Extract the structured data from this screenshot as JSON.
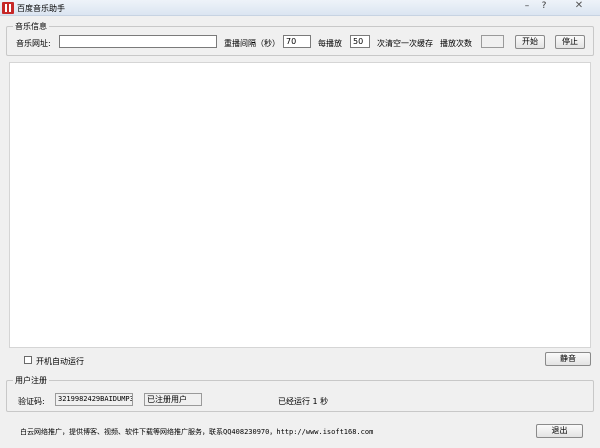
{
  "window": {
    "title": "百度音乐助手"
  },
  "music_info": {
    "legend": "音乐信息",
    "url_label": "音乐网址:",
    "url_value": "",
    "interval_label": "重播间隔（秒）",
    "interval_value": "70",
    "per_play_label": "每播放",
    "per_play_value": "50",
    "clear_cache_label": "次清空一次缓存",
    "play_count_label": "播放次数",
    "play_count_value": "",
    "start_button": "开始",
    "stop_button": "停止"
  },
  "options": {
    "autostart_label": "开机自动运行",
    "autostart_checked": false,
    "mute_button": "静音"
  },
  "registration": {
    "legend": "用户注册",
    "code_label": "验证码:",
    "code_value": "3219982429BAIDUMP3",
    "status_value": "已注册用户",
    "runtime_text": "已经运行 1 秒"
  },
  "footer": {
    "text": "白云网络推广，提供博客、视频、软件下载等网络推广服务，联系QQ408230970，http://www.isoft168.com",
    "exit_button": "退出"
  }
}
